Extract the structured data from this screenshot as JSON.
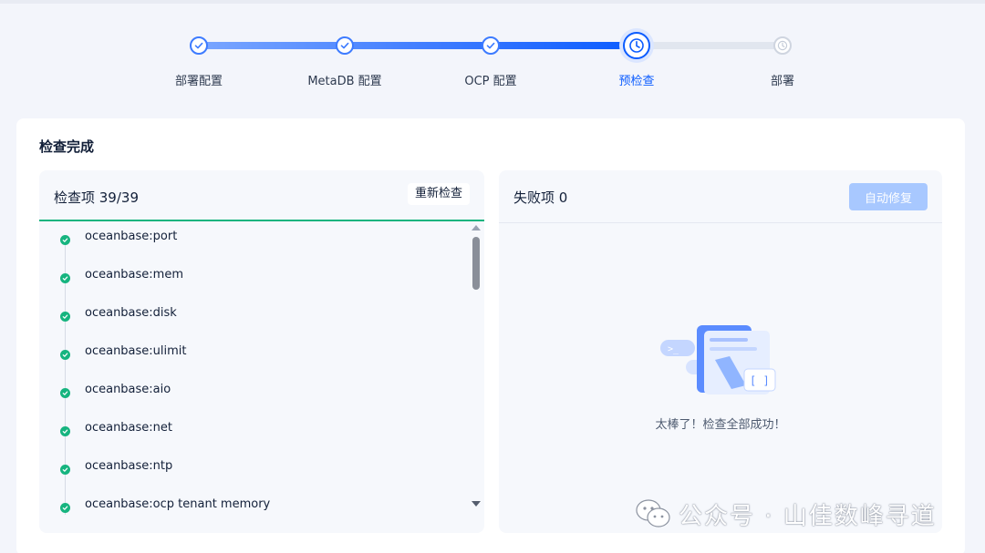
{
  "stepper": {
    "steps": [
      {
        "label": "部署配置",
        "state": "done"
      },
      {
        "label": "MetaDB 配置",
        "state": "done"
      },
      {
        "label": "OCP 配置",
        "state": "done"
      },
      {
        "label": "预检查",
        "state": "current"
      },
      {
        "label": "部署",
        "state": "todo"
      }
    ]
  },
  "card": {
    "title": "检查完成"
  },
  "check_panel": {
    "title": "检查项 39/39",
    "recheck_label": "重新检查",
    "items": [
      "oceanbase:port",
      "oceanbase:mem",
      "oceanbase:disk",
      "oceanbase:ulimit",
      "oceanbase:aio",
      "oceanbase:net",
      "oceanbase:ntp",
      "oceanbase:ocp tenant memory"
    ]
  },
  "fail_panel": {
    "title": "失败项 0",
    "autofix_label": "自动修复",
    "empty_text": "太棒了！检查全部成功！"
  },
  "watermark": {
    "text": "公众号 · 山佳数峰寻道"
  },
  "colors": {
    "primary": "#0b5cff",
    "success": "#16b47f",
    "autofix_disabled": "#a8c8ff"
  }
}
